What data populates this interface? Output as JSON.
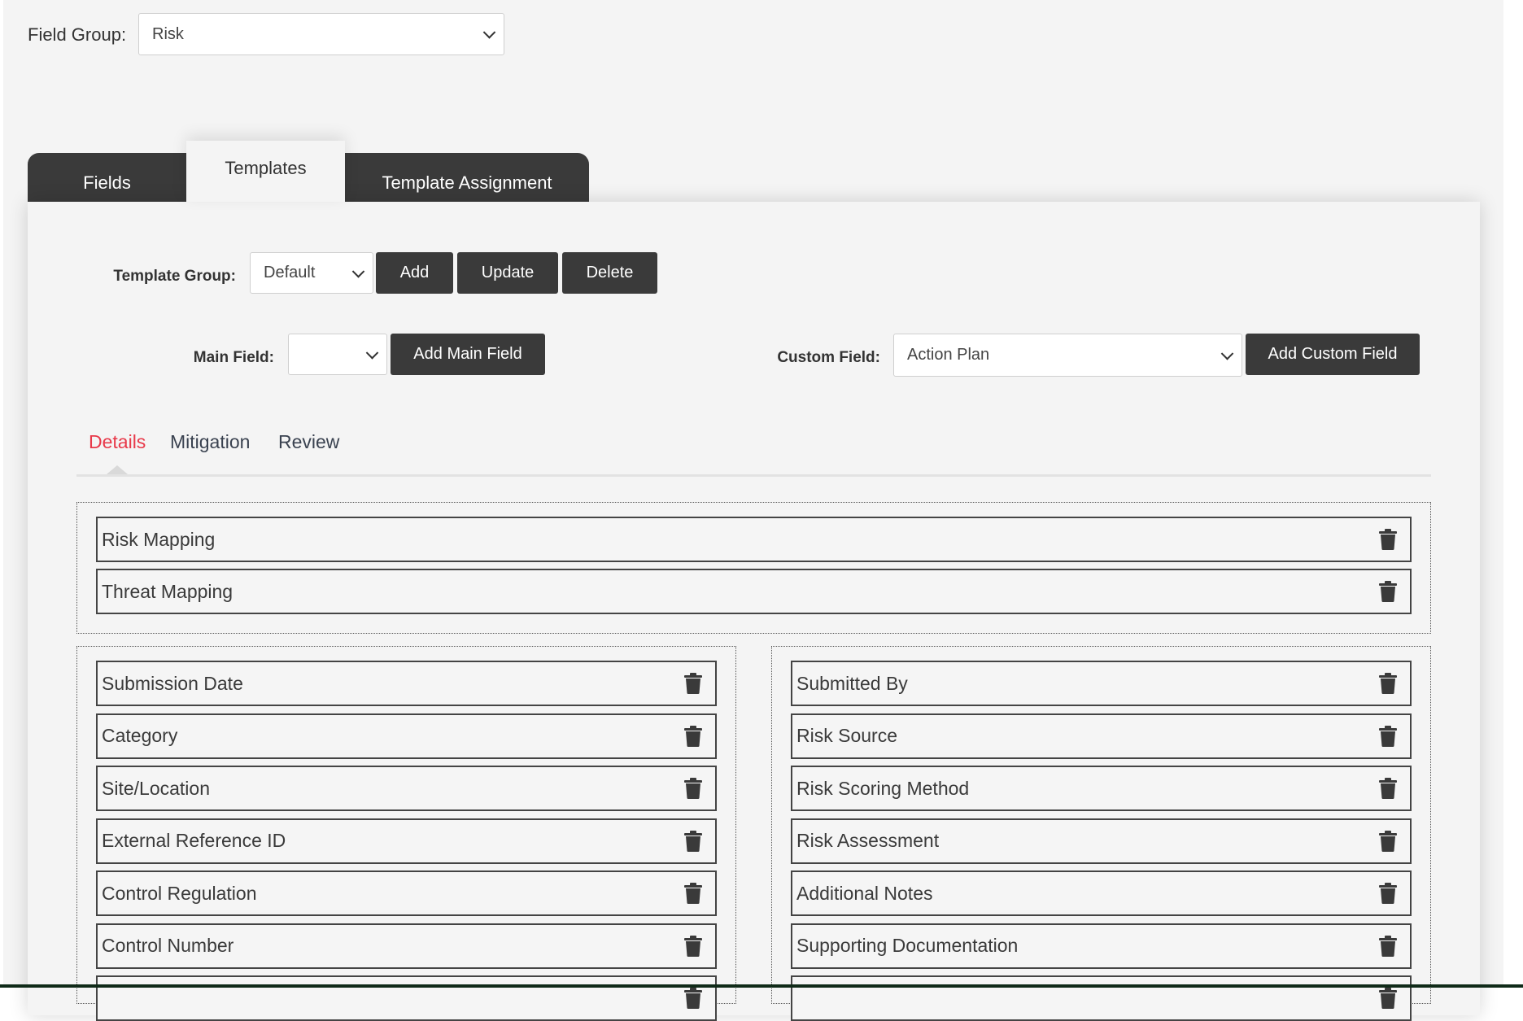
{
  "field_group": {
    "label": "Field Group:",
    "selected": "Risk"
  },
  "tabs": [
    {
      "label": "Fields",
      "active": false
    },
    {
      "label": "Templates",
      "active": true
    },
    {
      "label": "Template Assignment",
      "active": false
    }
  ],
  "template_group": {
    "label": "Template Group:",
    "selected": "Default",
    "add_label": "Add",
    "update_label": "Update",
    "delete_label": "Delete"
  },
  "main_field": {
    "label": "Main Field:",
    "selected": "",
    "button_label": "Add Main Field"
  },
  "custom_field": {
    "label": "Custom Field:",
    "selected": "Action Plan",
    "button_label": "Add Custom Field"
  },
  "subtabs": [
    {
      "label": "Details",
      "active": true
    },
    {
      "label": "Mitigation",
      "active": false
    },
    {
      "label": "Review",
      "active": false
    }
  ],
  "colors": {
    "active_subtab": "#e8394a",
    "dark": "#3a3a3a",
    "background": "#f4f4f4"
  },
  "top_fields": [
    "Risk Mapping",
    "Threat Mapping"
  ],
  "left_fields": [
    "Submission Date",
    "Category",
    "Site/Location",
    "External Reference ID",
    "Control Regulation",
    "Control Number",
    ""
  ],
  "right_fields": [
    "Submitted By",
    "Risk Source",
    "Risk Scoring Method",
    "Risk Assessment",
    "Additional Notes",
    "Supporting Documentation",
    ""
  ],
  "row_icon": "trash-icon"
}
